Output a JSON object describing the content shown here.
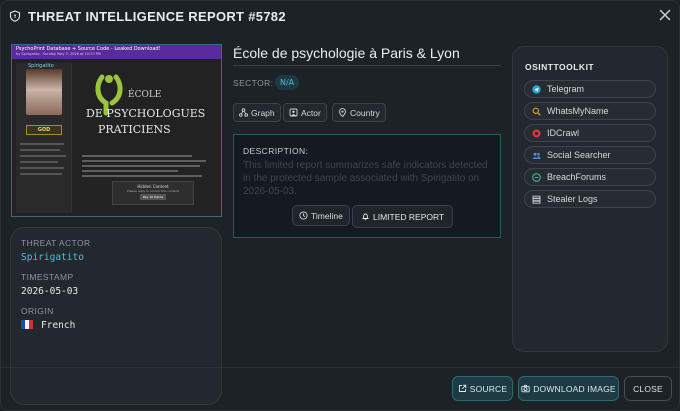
{
  "header": {
    "title": "THREAT INTELLIGENCE REPORT #5782"
  },
  "preview": {
    "forum_title": "PsychoPrint Database + Source Code - Leaked Download!",
    "forum_sub": "by Spirigatito - Sunday May 3, 2026 at 10:23 PM",
    "username": "Spirigatito",
    "badge": "GOD",
    "logo_line1": "ÉCOLE",
    "logo_line2": "DE PSYCHOLOGUES",
    "logo_line3": "PRATICIENS",
    "hidden_title": "Hidden Content",
    "hidden_sub": "Please reply to unlock this content",
    "hidden_btn": "Pay 10 Points"
  },
  "meta": {
    "actor_label": "THREAT ACTOR",
    "actor": "Spirigatito",
    "timestamp_label": "TIMESTAMP",
    "timestamp": "2026-05-03",
    "origin_label": "ORIGIN",
    "origin": "French"
  },
  "org": {
    "title": "École de psychologie à Paris & Lyon"
  },
  "sector": {
    "label": "SECTOR:",
    "value": "N/A"
  },
  "pills": {
    "graph": "Graph",
    "actor": "Actor",
    "country": "Country"
  },
  "description": {
    "label": "DESCRIPTION:",
    "text": "This limited report summarizes safe indicators detected in the protected sample associated with Spirigatito on 2026-05-03.",
    "timeline_btn": "Timeline",
    "limited_btn": "LIMITED REPORT"
  },
  "toolkit": {
    "title": "OSINTTOOLKIT",
    "items": [
      {
        "label": "Telegram",
        "icon": "telegram-icon",
        "color": "#2aa3d8"
      },
      {
        "label": "WhatsMyName",
        "icon": "search-icon",
        "color": "#e0a526"
      },
      {
        "label": "IDCrawl",
        "icon": "idcrawl-icon",
        "color": "#d9363e"
      },
      {
        "label": "Social Searcher",
        "icon": "users-icon",
        "color": "#4f8be0"
      },
      {
        "label": "BreachForums",
        "icon": "breachforums-icon",
        "color": "#3fb58a"
      },
      {
        "label": "Stealer Logs",
        "icon": "stack-icon",
        "color": "#c9d1d6"
      }
    ]
  },
  "footer": {
    "source": "SOURCE",
    "download": "DOWNLOAD IMAGE",
    "close": "CLOSE"
  },
  "colors": {
    "accent": "#3bc7e0",
    "panel": "#22282d",
    "flag_blue": "#1f4aa8",
    "flag_white": "#f2f2f2",
    "flag_red": "#d32f2f"
  }
}
